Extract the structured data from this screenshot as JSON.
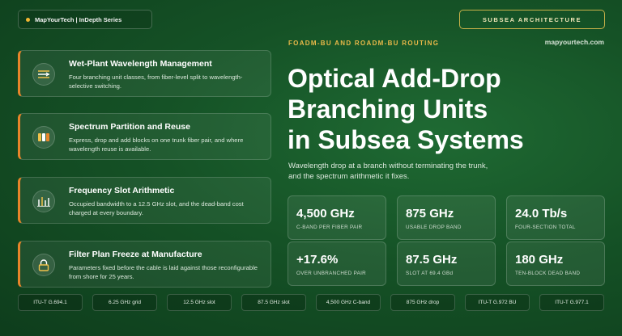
{
  "header": {
    "series_label": "MapYourTech | InDepth Series",
    "badge": "SUBSEA ARCHITECTURE"
  },
  "cards": [
    {
      "title": "Wet-Plant Wavelength Management",
      "desc": "Four branching unit classes, from fiber-level split to wavelength-selective switching.",
      "icon": "wavelength-lines-icon"
    },
    {
      "title": "Spectrum Partition and Reuse",
      "desc": "Express, drop and add blocks on one trunk fiber pair, and where wavelength reuse is available.",
      "icon": "spectrum-blocks-icon"
    },
    {
      "title": "Frequency Slot Arithmetic",
      "desc": "Occupied bandwidth to a 12.5 GHz slot, and the dead-band cost charged at every boundary.",
      "icon": "bar-chart-icon"
    },
    {
      "title": "Filter Plan Freeze at Manufacture",
      "desc": "Parameters fixed before the cable is laid against those reconfigurable from shore for 25 years.",
      "icon": "lock-icon"
    }
  ],
  "hero": {
    "kicker": "FOADM-BU AND ROADM-BU ROUTING",
    "site": "mapyourtech.com",
    "title_lines": [
      "Optical Add-Drop",
      "Branching Units",
      "in Subsea Systems"
    ],
    "subtitle": "Wavelength drop at a branch without terminating the trunk, and the spectrum arithmetic it fixes."
  },
  "stats": [
    {
      "value": "4,500 GHz",
      "label": "C-BAND PER FIBER PAIR"
    },
    {
      "value": "875 GHz",
      "label": "USABLE DROP BAND"
    },
    {
      "value": "24.0 Tb/s",
      "label": "FOUR-SECTION TOTAL"
    },
    {
      "value": "+17.6%",
      "label": "OVER UNBRANCHED PAIR"
    },
    {
      "value": "87.5 GHz",
      "label": "SLOT AT 69.4 GBd"
    },
    {
      "value": "180 GHz",
      "label": "TEN-BLOCK DEAD BAND"
    }
  ],
  "tags": [
    "ITU-T G.694.1",
    "6.25 GHz grid",
    "12.5 GHz slot",
    "87.5 GHz slot",
    "4,500 GHz C-band",
    "875 GHz drop",
    "ITU-T G.972 BU",
    "ITU-T G.977.1"
  ],
  "colors": {
    "accent_orange": "#e8852a",
    "accent_gold": "#e9b949",
    "background_green": "#155226"
  }
}
